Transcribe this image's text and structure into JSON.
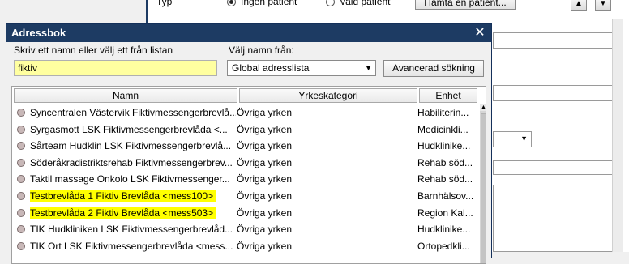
{
  "background": {
    "type_label": "Typ",
    "radio_none": "Ingen patient",
    "radio_selected": "Vald patient",
    "fetch_button": "Hämta en patient...",
    "up_icon": "arrow-up-icon",
    "down_icon": "arrow-down-icon"
  },
  "dialog": {
    "title": "Adressbok",
    "close_icon": "close-icon",
    "search_label": "Skriv ett namn eller välj ett från listan",
    "search_value": "fiktiv",
    "source_label": "Välj namn från:",
    "source_selected": "Global adresslista",
    "advanced_button": "Avancerad sökning",
    "colors": {
      "titlebar": "#1d3b63",
      "search_bg": "#ffffa0",
      "highlight": "#ffff00"
    }
  },
  "table": {
    "columns": [
      "Namn",
      "Yrkeskategori",
      "Enhet"
    ],
    "rows": [
      {
        "name": "Syncentralen Västervik Fiktivmessengerbrevlå...",
        "category": "Övriga yrken",
        "unit": "Habiliterin...",
        "highlighted": false
      },
      {
        "name": "Syrgasmott LSK Fiktivmessengerbrevlåda <...",
        "category": "Övriga yrken",
        "unit": "Medicinkli...",
        "highlighted": false
      },
      {
        "name": "Sårteam Hudklin LSK Fiktivmessengerbrevlå...",
        "category": "Övriga yrken",
        "unit": "Hudklinike...",
        "highlighted": false
      },
      {
        "name": "Söderåkradistriktsrehab Fiktivmessengerbrev...",
        "category": "Övriga yrken",
        "unit": "Rehab söd...",
        "highlighted": false
      },
      {
        "name": "Taktil massage Onkolo LSK Fiktivmessenger...",
        "category": "Övriga yrken",
        "unit": "Rehab söd...",
        "highlighted": false
      },
      {
        "name": "Testbrevlåda 1 Fiktiv Brevlåda <mess100>",
        "category": "Övriga yrken",
        "unit": "Barnhälsov...",
        "highlighted": true
      },
      {
        "name": "Testbrevlåda 2 Fiktiv Brevlåda <mess503>",
        "category": "Övriga yrken",
        "unit": "Region Kal...",
        "highlighted": true
      },
      {
        "name": "TIK Hudkliniken LSK Fiktivmessengerbrevlåd...",
        "category": "Övriga yrken",
        "unit": "Hudklinike...",
        "highlighted": false
      },
      {
        "name": "TIK Ort LSK Fiktivmessengerbrevlåda <mess...",
        "category": "Övriga yrken",
        "unit": "Ortopedkli...",
        "highlighted": false
      }
    ]
  }
}
